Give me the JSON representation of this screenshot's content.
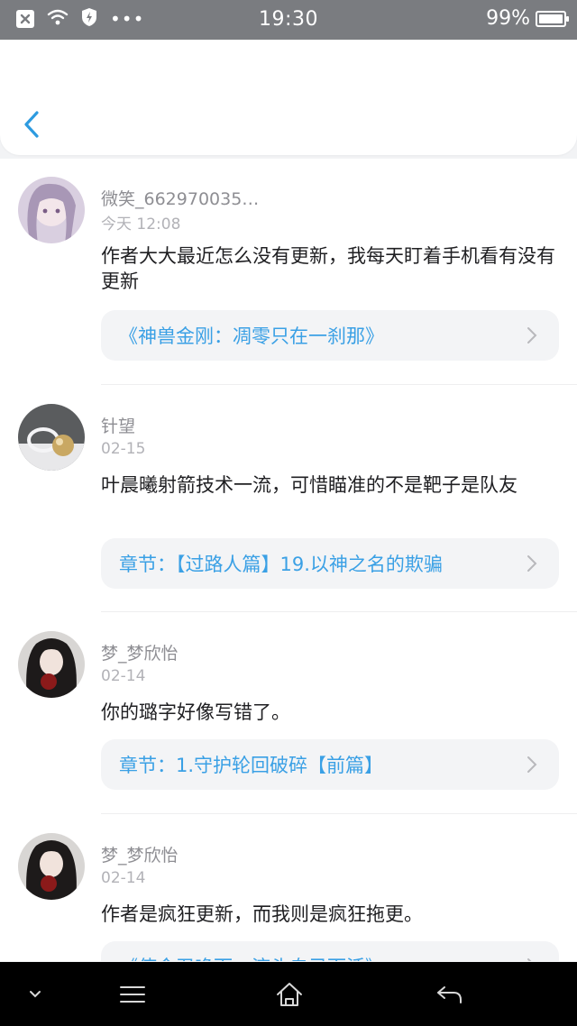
{
  "status_bar": {
    "time": "19:30",
    "battery": "99%",
    "icons": [
      "close-app-icon",
      "wifi-icon",
      "shield-icon",
      "more-dots-icon",
      "battery-icon"
    ]
  },
  "header": {
    "back_icon": "back-chevron-icon",
    "accent_color": "#2d9be0"
  },
  "comments": [
    {
      "username": "微笑_662970035…",
      "time": "今天 12:08",
      "content": "作者大大最近怎么没有更新，我每天盯着手机看有没有更新",
      "link": "《神兽金刚：凋零只在一刹那》"
    },
    {
      "username": "针望",
      "time": "02-15",
      "content": "叶晨曦射箭技术一流，可惜瞄准的不是靶子是队友",
      "link": "章节：【过路人篇】19.以神之名的欺骗"
    },
    {
      "username": "梦_梦欣怡",
      "time": "02-14",
      "content": "你的璐字好像写错了。",
      "link": "章节：1.守护轮回破碎【前篇】"
    },
    {
      "username": "梦_梦欣怡",
      "time": "02-14",
      "content": "作者是疯狂更新，而我则是疯狂拖更。",
      "link": "《使命召唤而，济头自己而活》"
    }
  ],
  "nav_bar": {
    "icons": [
      "collapse-chevron-icon",
      "menu-icon",
      "home-icon",
      "back-arrow-icon"
    ]
  },
  "colors": {
    "status_bar_bg": "#7a7c80",
    "link_text": "#3aa0e5",
    "card_bg": "#f3f4f6",
    "nav_bar_bg": "#000000"
  }
}
